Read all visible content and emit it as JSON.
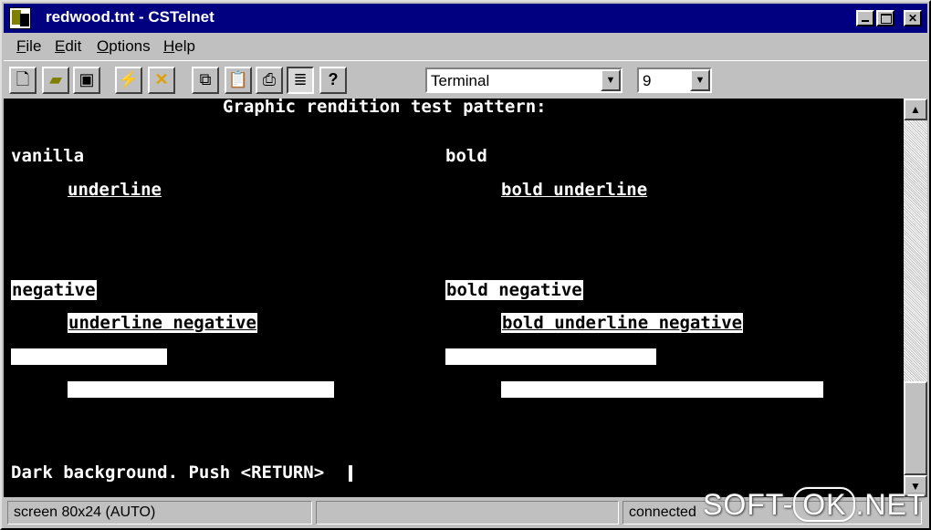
{
  "window": {
    "title": "redwood.tnt - CSTelnet"
  },
  "menu": [
    "File",
    "Edit",
    "Options",
    "Help"
  ],
  "toolbar": {
    "font_combo": {
      "value": "Terminal"
    },
    "size_combo": {
      "value": "9"
    }
  },
  "terminal": {
    "heading": "Graphic rendition test pattern:",
    "vanilla": "vanilla",
    "underline": "underline",
    "bold": "bold",
    "bold_underline": "bold underline",
    "negative": "negative",
    "underline_negative": "underline negative",
    "bold_negative": "bold negative",
    "bold_underline_negative": "bold underline negative",
    "prompt": "Dark background. Push <RETURN>"
  },
  "status": {
    "screen": "screen 80x24 (AUTO)",
    "connection": "connected"
  },
  "watermark": {
    "left": "SOFT-",
    "ok": "OK",
    "right": ".NET"
  },
  "colors": {
    "titlebar": "#000080",
    "chrome": "#c0c0c0",
    "terminal_bg": "#000000"
  }
}
